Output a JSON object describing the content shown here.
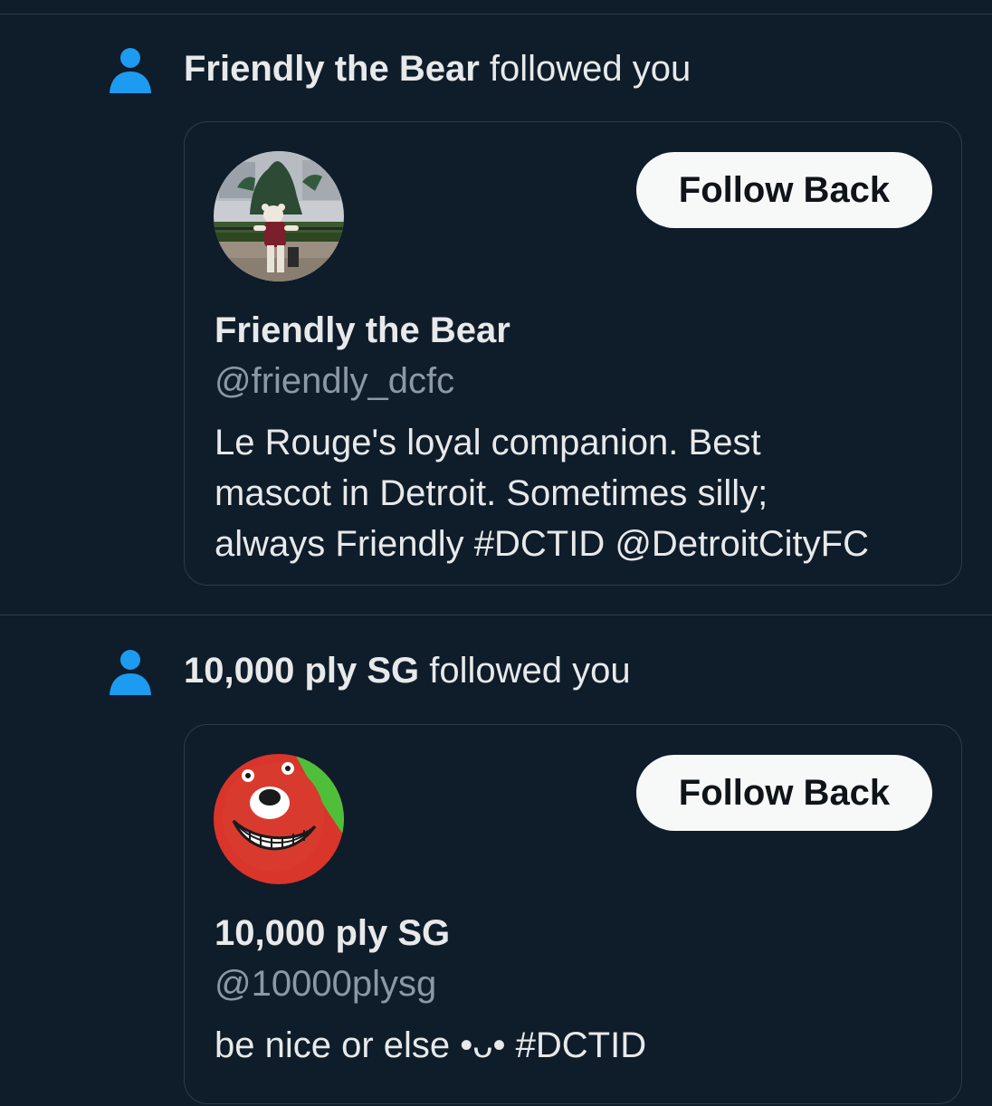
{
  "colors": {
    "background": "#0f1c2a",
    "divider": "#2f3b47",
    "accent_icon": "#1d9bf0",
    "text_primary": "#e7e9ea",
    "text_secondary": "#8b98a5",
    "button_bg": "#f7f9f9",
    "button_text": "#0f1419"
  },
  "notifications": [
    {
      "icon": "person-icon",
      "actor": "Friendly the Bear",
      "action": "followed you",
      "card": {
        "avatar": "bear-mascot-photo",
        "follow_button": "Follow Back",
        "name": "Friendly the Bear",
        "handle": "@friendly_dcfc",
        "bio_lines": [
          "Le Rouge's loyal companion. Best",
          "mascot in Detroit. Sometimes silly;",
          "always Friendly #DCTID @DetroitCityFC"
        ]
      }
    },
    {
      "icon": "person-icon",
      "actor": "10,000 ply SG",
      "action": "followed you",
      "card": {
        "avatar": "red-beaver-cartoon",
        "follow_button": "Follow Back",
        "name": "10,000 ply SG",
        "handle": "@10000plysg",
        "bio_lines": [
          "be nice or else •ᴗ• #DCTID"
        ]
      }
    }
  ]
}
